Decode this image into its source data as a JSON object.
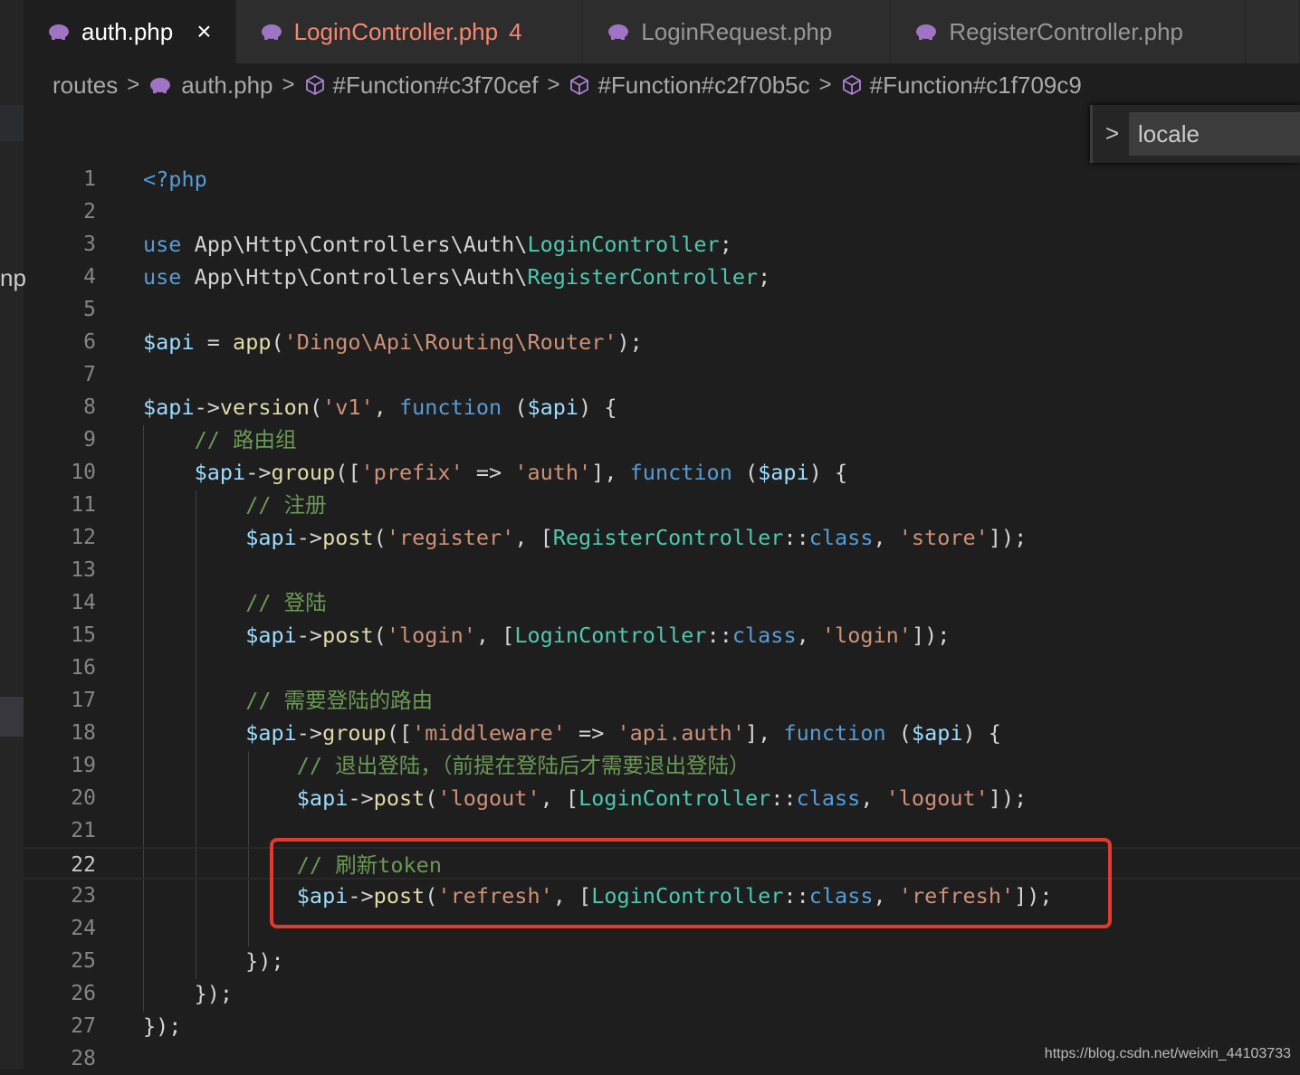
{
  "tabs": [
    {
      "label": "auth.php",
      "active": true,
      "close": "×"
    },
    {
      "label": "LoginController.php",
      "badge": "4",
      "error": true
    },
    {
      "label": "LoginRequest.php"
    },
    {
      "label": "RegisterController.php"
    }
  ],
  "breadcrumb": [
    "routes",
    "auth.php",
    "#Function#c3f70cef",
    "#Function#c2f70b5c",
    "#Function#c1f709c9"
  ],
  "find_widget": {
    "value": "locale"
  },
  "sidebar_fragment": "np",
  "lines": [
    {
      "n": 1,
      "code": "<?php"
    },
    {
      "n": 2,
      "code": ""
    },
    {
      "n": 3,
      "code": "use App\\Http\\Controllers\\Auth\\LoginController;"
    },
    {
      "n": 4,
      "code": "use App\\Http\\Controllers\\Auth\\RegisterController;"
    },
    {
      "n": 5,
      "code": ""
    },
    {
      "n": 6,
      "code": "$api = app('Dingo\\Api\\Routing\\Router');"
    },
    {
      "n": 7,
      "code": ""
    },
    {
      "n": 8,
      "code": "$api->version('v1', function ($api) {"
    },
    {
      "n": 9,
      "code": "    // 路由组"
    },
    {
      "n": 10,
      "code": "    $api->group(['prefix' => 'auth'], function ($api) {"
    },
    {
      "n": 11,
      "code": "        // 注册"
    },
    {
      "n": 12,
      "code": "        $api->post('register', [RegisterController::class, 'store']);"
    },
    {
      "n": 13,
      "code": ""
    },
    {
      "n": 14,
      "code": "        // 登陆"
    },
    {
      "n": 15,
      "code": "        $api->post('login', [LoginController::class, 'login']);"
    },
    {
      "n": 16,
      "code": ""
    },
    {
      "n": 17,
      "code": "        // 需要登陆的路由"
    },
    {
      "n": 18,
      "code": "        $api->group(['middleware' => 'api.auth'], function ($api) {"
    },
    {
      "n": 19,
      "code": "            // 退出登陆，（前提在登陆后才需要退出登陆）"
    },
    {
      "n": 20,
      "code": "            $api->post('logout', [LoginController::class, 'logout']);"
    },
    {
      "n": 21,
      "code": ""
    },
    {
      "n": 22,
      "code": "            // 刷新token"
    },
    {
      "n": 23,
      "code": "            $api->post('refresh', [LoginController::class, 'refresh']);"
    },
    {
      "n": 24,
      "code": ""
    },
    {
      "n": 25,
      "code": "        });"
    },
    {
      "n": 26,
      "code": "    });"
    },
    {
      "n": 27,
      "code": "});"
    },
    {
      "n": 28,
      "code": ""
    }
  ],
  "current_line": 22,
  "highlight_color": "#e03b2f",
  "watermark": "https://blog.csdn.net/weixin_44103733"
}
